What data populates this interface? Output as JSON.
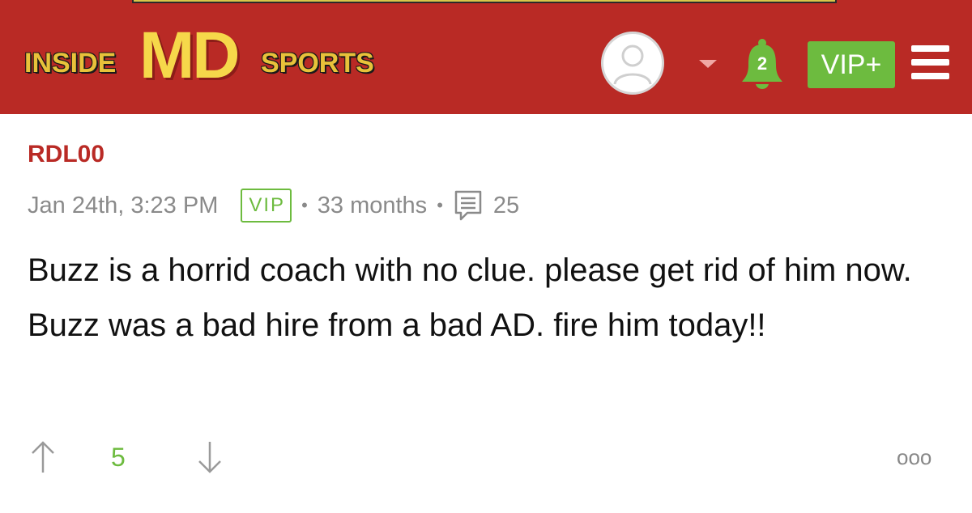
{
  "header": {
    "logo": {
      "prefix": "INSIDE",
      "main": "MD",
      "suffix": "SPORTS"
    },
    "notifications_count": "2",
    "vip_button_label": "VIP+",
    "colors": {
      "brand_red": "#b92a25",
      "accent_green": "#6dbb3f",
      "logo_yellow": "#f6d84a"
    }
  },
  "post": {
    "username": "RDL00",
    "timestamp": "Jan 24th, 3:23 PM",
    "badge": "VIP",
    "member_duration": "33 months",
    "comment_count": "25",
    "body": "Buzz is a horrid coach with no clue. please get rid of him now. Buzz was a bad hire from a bad AD. fire him today!!",
    "votes": {
      "score": "5"
    },
    "more_label": "ooo"
  },
  "icons": [
    "user-avatar-icon",
    "chevron-down-icon",
    "bell-icon",
    "hamburger-menu-icon",
    "comment-icon",
    "upvote-arrow-icon",
    "downvote-arrow-icon",
    "more-options-icon"
  ]
}
